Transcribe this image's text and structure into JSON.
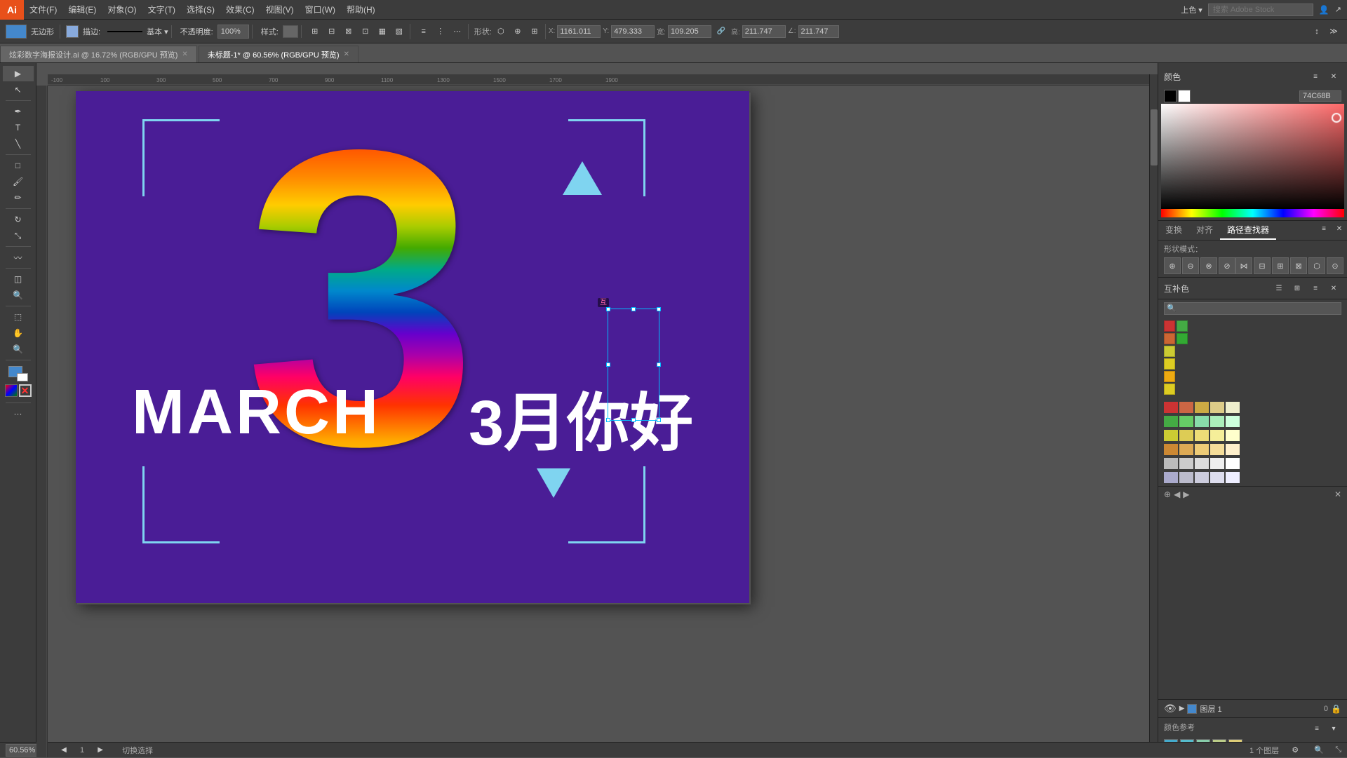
{
  "app": {
    "title": "Ai",
    "icon_color": "#e8501a"
  },
  "menu": {
    "items": [
      "文件(F)",
      "编辑(E)",
      "对象(O)",
      "文字(T)",
      "选择(S)",
      "效果(C)",
      "视图(V)",
      "窗口(W)",
      "帮助(H)"
    ]
  },
  "toolbar": {
    "shape_label": "无边形",
    "stroke_label": "描边:",
    "opacity_label": "不透明度:",
    "opacity_value": "100%",
    "style_label": "样式:",
    "x_label": "X:",
    "x_value": "1161.011",
    "y_label": "Y:",
    "y_value": "479.333",
    "w_label": "宽:",
    "w_value": "109.205",
    "h_label": "高:",
    "h_value": "211.747",
    "angle_label": "∠:"
  },
  "tabs": [
    {
      "name": "file1",
      "label": "炫彩数字海报设计.ai @ 16.72% (RGB/GPU 预览)",
      "active": false
    },
    {
      "name": "file2",
      "label": "未标题-1* @ 60.56% (RGB/GPU 预览)",
      "active": true
    }
  ],
  "canvas": {
    "zoom": "60.56%",
    "artboard_bg": "#4a1d96",
    "page_label": "1",
    "mode_label": "切换选择"
  },
  "artboard_content": {
    "march_text": "MARCH",
    "chinese_text": "3月你好",
    "big_number": "3"
  },
  "right_panel": {
    "color_title": "颜色",
    "hex_value": "74C68B",
    "black_swatch": "#000",
    "white_swatch": "#fff",
    "panel_tabs": [
      "变换",
      "对齐",
      "路径查找器"
    ],
    "active_tab": "路径查找器",
    "shape_mode_label": "形状模式：",
    "complement_title": "互补色",
    "complement_search_placeholder": "",
    "color_ref_label": "颜色参考",
    "layer_name": "图层 1",
    "color_swatches": [
      "#cc3333",
      "#44aa44",
      "#cc6633",
      "#33aa33",
      "#cccc33",
      "#ddcc22",
      "#eeaa11",
      "#ddcc22"
    ],
    "palette_rows": [
      [
        "#cc3333",
        "#cc6644",
        "#ccaa44",
        "#ddcc88",
        "#eeeecc"
      ],
      [
        "#44aa44",
        "#66cc66",
        "#88ddaa",
        "#aaeebb",
        "#ccffdd"
      ],
      [
        "#cccc33",
        "#ddcc55",
        "#eedd77",
        "#f5ee99",
        "#ffffcc"
      ],
      [
        "#cc8833",
        "#ddaa55",
        "#eecc77",
        "#f5dd99",
        "#fff0cc"
      ],
      [
        "#bbbbbb",
        "#cccccc",
        "#dddddd",
        "#eeeeee",
        "#ffffff"
      ]
    ],
    "color_ref_swatches": [
      "#44aacc",
      "#55bbcc",
      "#88ccaa",
      "#bbcc88",
      "#ddcc77"
    ],
    "layer_icon_visible": "👁",
    "layer_icon_lock": "🔒"
  },
  "status_bar": {
    "zoom": "60.56%",
    "page": "1",
    "mode": "切换选择",
    "info": "1 个图层",
    "resize_label": ""
  }
}
